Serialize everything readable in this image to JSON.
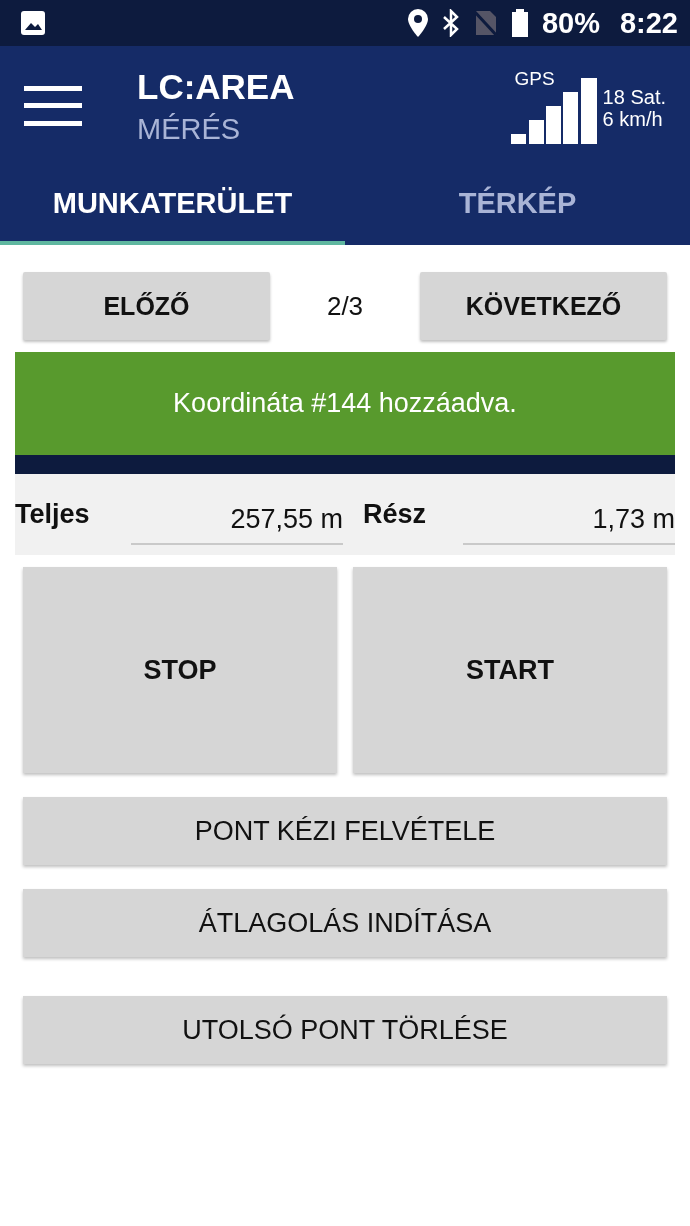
{
  "status_bar": {
    "battery": "80%",
    "time": "8:22"
  },
  "app_bar": {
    "title": "LC:AREA",
    "subtitle": "MÉRÉS",
    "gps": {
      "label": "GPS",
      "satellites": "18 Sat.",
      "speed": "6 km/h"
    }
  },
  "tabs": [
    {
      "label": "MUNKATERÜLET",
      "selected": true
    },
    {
      "label": "TÉRKÉP",
      "selected": false
    }
  ],
  "pager": {
    "previous": "ELŐZŐ",
    "position": "2/3",
    "next": "KÖVETKEZŐ"
  },
  "message": "Koordináta #144 hozzáadva.",
  "totals": [
    {
      "label": "Teljes",
      "value": "257,55 m"
    },
    {
      "label": "Rész",
      "value": "1,73 m"
    }
  ],
  "big_buttons": [
    "STOP",
    "START"
  ],
  "actions": [
    "PONT KÉZI FELVÉTELE",
    "ÁTLAGOLÁS INDÍTÁSA",
    "UTOLSÓ PONT TÖRLÉSE"
  ]
}
